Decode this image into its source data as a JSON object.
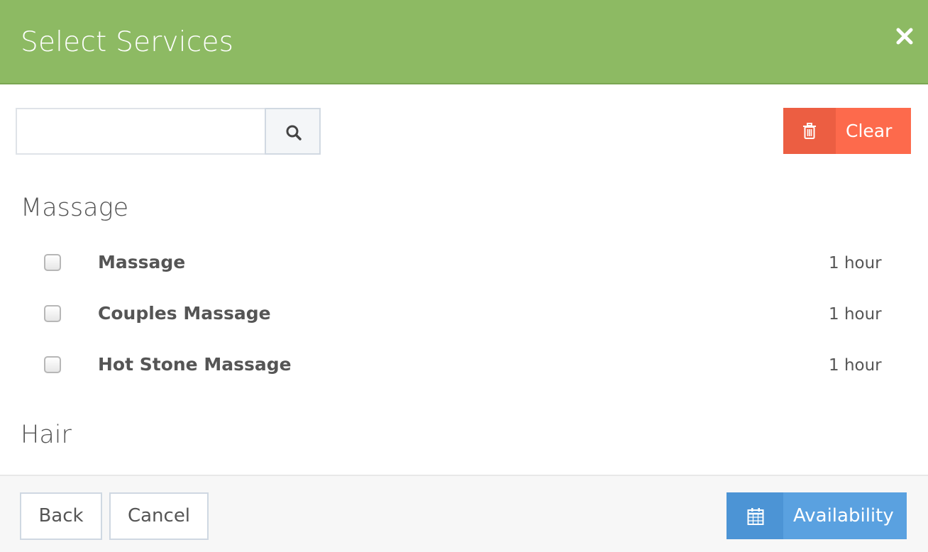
{
  "header": {
    "title": "Select Services",
    "close_icon": "close-icon",
    "background_color": "#8dba63"
  },
  "search": {
    "value": "",
    "placeholder": "",
    "button_icon": "search-icon"
  },
  "clear_button": {
    "label": "Clear",
    "icon": "trash-icon",
    "color": "#fd6a4c"
  },
  "categories": [
    {
      "title": "Massage",
      "services": [
        {
          "name": "Massage",
          "duration": "1 hour",
          "checked": false
        },
        {
          "name": "Couples Massage",
          "duration": "1 hour",
          "checked": false
        },
        {
          "name": "Hot Stone Massage",
          "duration": "1 hour",
          "checked": false
        }
      ]
    },
    {
      "title": "Hair",
      "services": []
    }
  ],
  "footer": {
    "back_label": "Back",
    "cancel_label": "Cancel",
    "availability_label": "Availability",
    "availability_icon": "calendar-icon",
    "availability_color": "#5aa1e0"
  }
}
